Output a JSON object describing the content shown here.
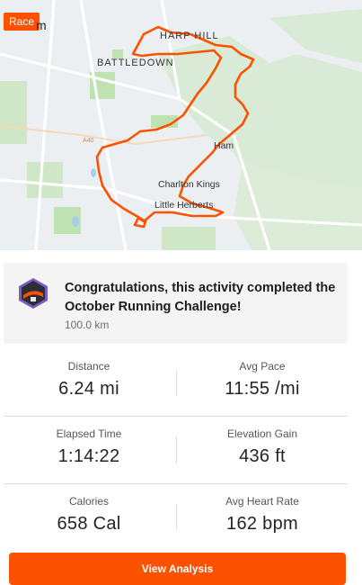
{
  "map": {
    "badge": "Race",
    "labels": {
      "top_left": "m",
      "hill": "HARP HILL",
      "battledown": "BATTLEDOWN",
      "ham": "Ham",
      "charlton": "Charlton Kings",
      "herberts": "Little Herberts",
      "road": "A40"
    },
    "route_color": "#fc5200"
  },
  "challenge": {
    "title": "Congratulations, this activity completed the October Running Challenge!",
    "distance": "100.0 km",
    "badge_icon": "challenge-badge-icon"
  },
  "stats": [
    {
      "left": {
        "label": "Distance",
        "value": "6.24 mi"
      },
      "right": {
        "label": "Avg Pace",
        "value": "11:55 /mi"
      }
    },
    {
      "left": {
        "label": "Elapsed Time",
        "value": "1:14:22"
      },
      "right": {
        "label": "Elevation Gain",
        "value": "436 ft"
      }
    },
    {
      "left": {
        "label": "Calories",
        "value": "658 Cal"
      },
      "right": {
        "label": "Avg Heart Rate",
        "value": "162 bpm"
      }
    }
  ],
  "cta": {
    "label": "View Analysis"
  },
  "colors": {
    "accent": "#fc5200",
    "card_bg": "#f4f4f5"
  }
}
